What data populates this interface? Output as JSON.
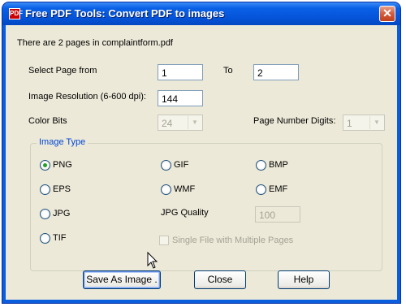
{
  "window": {
    "title": "Free PDF Tools: Convert PDF to images",
    "app_icon_text": "PDF",
    "close_symbol": "✕"
  },
  "info_text": "There are 2 pages in complaintform.pdf",
  "page_range": {
    "from_label": "Select Page from",
    "from_value": "1",
    "to_label": "To",
    "to_value": "2"
  },
  "resolution": {
    "label": "Image Resolution (6-600 dpi):",
    "value": "144"
  },
  "color_bits": {
    "label": "Color Bits",
    "value": "24"
  },
  "page_digits": {
    "label": "Page Number Digits:",
    "value": "1"
  },
  "image_type": {
    "title": "Image Type",
    "options": [
      "PNG",
      "GIF",
      "BMP",
      "EPS",
      "WMF",
      "EMF",
      "JPG",
      "TIF"
    ],
    "selected": "PNG"
  },
  "jpg_quality": {
    "label": "JPG Quality",
    "value": "100"
  },
  "single_file": {
    "label": "Single File with Multiple Pages",
    "checked": false
  },
  "buttons": {
    "save": "Save As Image .",
    "close": "Close",
    "help": "Help"
  },
  "icons": [
    "pdf-app-icon",
    "close-icon",
    "dropdown-arrow-icon",
    "mouse-cursor-icon"
  ]
}
